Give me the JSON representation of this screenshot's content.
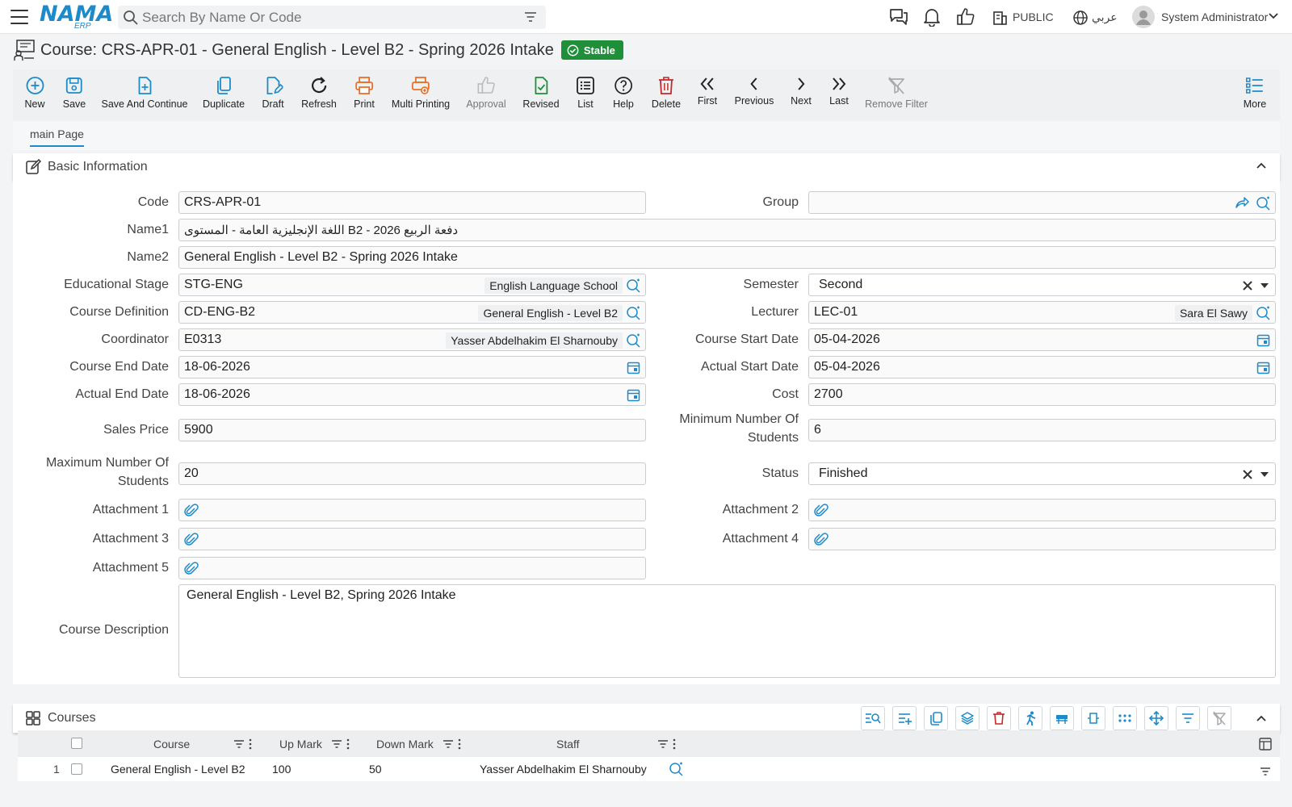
{
  "topbar": {
    "logo": "NAMA",
    "logo_sub": "ERP",
    "search_placeholder": "Search By Name Or Code",
    "branch": "PUBLIC",
    "language": "عربي",
    "user": "System Administrator"
  },
  "title": {
    "text": "Course: CRS-APR-01 - General English - Level B2 - Spring 2026 Intake",
    "badge": "Stable"
  },
  "toolbar": {
    "new": "New",
    "save": "Save",
    "save_continue": "Save And Continue",
    "duplicate": "Duplicate",
    "draft": "Draft",
    "refresh": "Refresh",
    "print": "Print",
    "multi_printing": "Multi Printing",
    "approval": "Approval",
    "revised": "Revised",
    "list": "List",
    "help": "Help",
    "delete": "Delete",
    "first": "First",
    "previous": "Previous",
    "next": "Next",
    "last": "Last",
    "remove_filter": "Remove Filter",
    "more": "More"
  },
  "tabs": {
    "main": "main Page"
  },
  "sections": {
    "basic": "Basic Information",
    "courses": "Courses"
  },
  "form": {
    "code_label": "Code",
    "code": "CRS-APR-01",
    "group_label": "Group",
    "group": "",
    "name1_label": "Name1",
    "name1": "دفعة الربيع 2026 - B2 اللغة الإنجليزية العامة - المستوى",
    "name2_label": "Name2",
    "name2": "General English - Level B2 - Spring 2026 Intake",
    "edu_stage_label": "Educational Stage",
    "edu_stage": "STG-ENG",
    "edu_stage_name": "English Language School",
    "semester_label": "Semester",
    "semester": "Second",
    "course_def_label": "Course Definition",
    "course_def": "CD-ENG-B2",
    "course_def_name": "General English - Level B2",
    "lecturer_label": "Lecturer",
    "lecturer": "LEC-01",
    "lecturer_name": "Sara El Sawy",
    "coordinator_label": "Coordinator",
    "coordinator": "E0313",
    "coordinator_name": "Yasser Abdelhakim El Sharnouby",
    "course_start_label": "Course Start Date",
    "course_start": "05-04-2026",
    "course_end_label": "Course End Date",
    "course_end": "18-06-2026",
    "actual_start_label": "Actual Start Date",
    "actual_start": "05-04-2026",
    "actual_end_label": "Actual End Date",
    "actual_end": "18-06-2026",
    "cost_label": "Cost",
    "cost": "2700",
    "sales_price_label": "Sales Price",
    "sales_price": "5900",
    "min_students_label_1": "Minimum Number Of",
    "min_students_label_2": "Students",
    "min_students": "6",
    "max_students_label_1": "Maximum Number Of",
    "max_students_label_2": "Students",
    "max_students": "20",
    "status_label": "Status",
    "status": "Finished",
    "att1_label": "Attachment 1",
    "att2_label": "Attachment 2",
    "att3_label": "Attachment 3",
    "att4_label": "Attachment 4",
    "att5_label": "Attachment 5",
    "desc_label": "Course Description",
    "desc": "General English - Level B2, Spring 2026 Intake"
  },
  "grid": {
    "columns": [
      "Course",
      "Up Mark",
      "Down Mark",
      "Staff"
    ],
    "rows": [
      {
        "num": "1",
        "course": "General English - Level B2",
        "up": "100",
        "down": "50",
        "staff": "Yasser Abdelhakim El Sharnouby"
      }
    ]
  },
  "colors": {
    "accent": "#1d8bc9",
    "stable": "#1f8f3a",
    "delete": "#c62828",
    "print": "#e8712a"
  }
}
